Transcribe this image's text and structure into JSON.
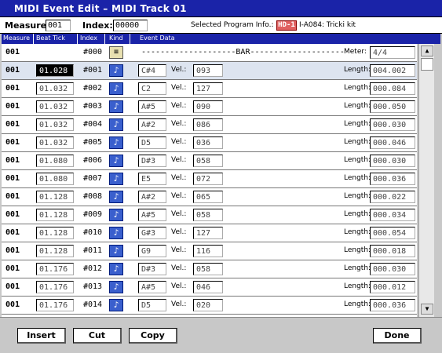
{
  "title": "MIDI Event Edit – MIDI Track 01",
  "info": {
    "measure_label": "Measure:",
    "measure_value": "001",
    "index_label": "Index:",
    "index_value": "00000",
    "program_label": "Selected Program Info.:",
    "program_badge": "HD-1",
    "program_value": "I-A084: Tricki kit"
  },
  "headers": [
    "Measure",
    "Beat Tick",
    "Index",
    "Kind",
    "Event Data"
  ],
  "bar_row": {
    "measure": "001",
    "index": "#000",
    "event": "--------------------BAR--------------------",
    "meter_label": "Meter:",
    "meter": "4/4"
  },
  "rows": [
    {
      "measure": "001",
      "tick": "01.028",
      "index": "#001",
      "note": "C#4",
      "vel": "093",
      "length": "004.002"
    },
    {
      "measure": "001",
      "tick": "01.032",
      "index": "#002",
      "note": "C2",
      "vel": "127",
      "length": "000.084"
    },
    {
      "measure": "001",
      "tick": "01.032",
      "index": "#003",
      "note": "A#5",
      "vel": "090",
      "length": "000.050"
    },
    {
      "measure": "001",
      "tick": "01.032",
      "index": "#004",
      "note": "A#2",
      "vel": "086",
      "length": "000.030"
    },
    {
      "measure": "001",
      "tick": "01.032",
      "index": "#005",
      "note": "D5",
      "vel": "036",
      "length": "000.046"
    },
    {
      "measure": "001",
      "tick": "01.080",
      "index": "#006",
      "note": "D#3",
      "vel": "058",
      "length": "000.030"
    },
    {
      "measure": "001",
      "tick": "01.080",
      "index": "#007",
      "note": "E5",
      "vel": "072",
      "length": "000.036"
    },
    {
      "measure": "001",
      "tick": "01.128",
      "index": "#008",
      "note": "A#2",
      "vel": "065",
      "length": "000.022"
    },
    {
      "measure": "001",
      "tick": "01.128",
      "index": "#009",
      "note": "A#5",
      "vel": "058",
      "length": "000.034"
    },
    {
      "measure": "001",
      "tick": "01.128",
      "index": "#010",
      "note": "G#3",
      "vel": "127",
      "length": "000.054"
    },
    {
      "measure": "001",
      "tick": "01.128",
      "index": "#011",
      "note": "G9",
      "vel": "116",
      "length": "000.018"
    },
    {
      "measure": "001",
      "tick": "01.176",
      "index": "#012",
      "note": "D#3",
      "vel": "058",
      "length": "000.030"
    },
    {
      "measure": "001",
      "tick": "01.176",
      "index": "#013",
      "note": "A#5",
      "vel": "046",
      "length": "000.012"
    },
    {
      "measure": "001",
      "tick": "01.176",
      "index": "#014",
      "note": "D5",
      "vel": "020",
      "length": "000.036"
    }
  ],
  "labels": {
    "vel": "Vel.:",
    "length": "Length:"
  },
  "buttons": {
    "insert": "Insert",
    "cut": "Cut",
    "copy": "Copy",
    "done": "Done"
  },
  "icons": {
    "note_kind": "note-icon",
    "bar_kind": "bar-icon"
  }
}
